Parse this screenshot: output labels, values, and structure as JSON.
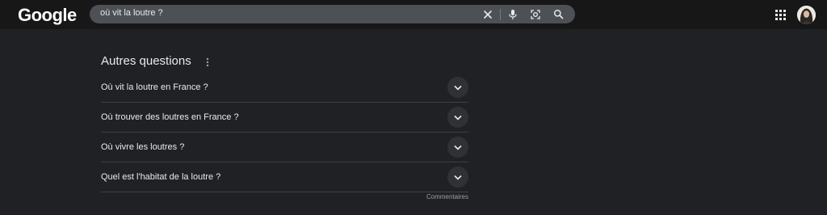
{
  "header": {
    "logo_text": "Google",
    "search": {
      "query": "où vit la loutre ?"
    },
    "icons": [
      "clear-icon",
      "microphone-icon",
      "lens-icon",
      "search-icon",
      "apps-grid-icon"
    ]
  },
  "paa": {
    "title": "Autres questions",
    "questions": [
      {
        "text": "Où vit la loutre en France ?"
      },
      {
        "text": "Où trouver des loutres en France ?"
      },
      {
        "text": "Où vivre les loutres ?"
      },
      {
        "text": "Quel est l'habitat de la loutre ?"
      }
    ],
    "feedback": "Commentaires"
  },
  "colors": {
    "background": "#202124",
    "header": "#171717",
    "searchbox": "#4d5156",
    "text": "#e8eaed",
    "muted": "#9aa0a6"
  }
}
